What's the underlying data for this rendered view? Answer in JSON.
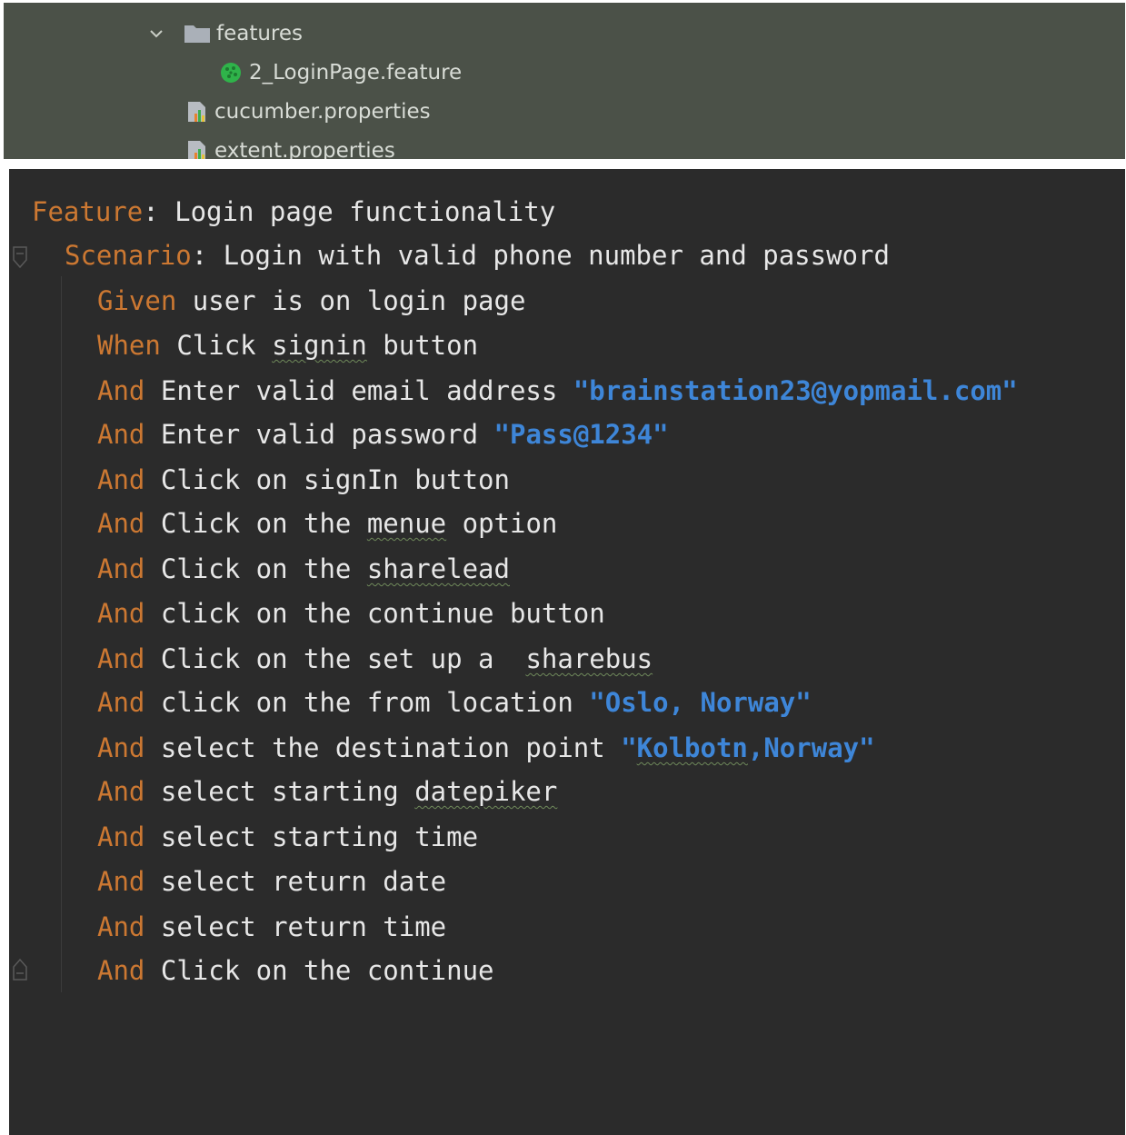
{
  "colors": {
    "tree_background": "#4b5148",
    "editor_background": "#2b2b2b",
    "keyword": "#cc7832",
    "string": "#3e86d8",
    "text": "#e7e7e7"
  },
  "project_tree": {
    "items": [
      {
        "label": "features",
        "icon": "folder-icon",
        "expanded": true
      },
      {
        "label": "2_LoginPage.feature",
        "icon": "cucumber-icon"
      },
      {
        "label": "cucumber.properties",
        "icon": "properties-file-icon"
      },
      {
        "label": "extent.properties",
        "icon": "properties-file-icon"
      }
    ]
  },
  "editor": {
    "feature": {
      "keyword": "Feature",
      "title": "Login page functionality"
    },
    "scenario": {
      "keyword": "Scenario",
      "title": "Login with valid phone number and password"
    },
    "steps": [
      {
        "keyword": "Given",
        "text": "user is on login page"
      },
      {
        "keyword": "When",
        "pre": "Click ",
        "typo": "signin",
        "post": " button"
      },
      {
        "keyword": "And",
        "text": "Enter valid email address",
        "string": "\"brainstation23@yopmail.com\""
      },
      {
        "keyword": "And",
        "text": "Enter valid password",
        "string": "\"Pass@1234\""
      },
      {
        "keyword": "And",
        "text": "Click on signIn button"
      },
      {
        "keyword": "And",
        "pre": "Click on the ",
        "typo": "menue",
        "post": " option"
      },
      {
        "keyword": "And",
        "pre": "Click on the ",
        "typo": "sharelead",
        "post": ""
      },
      {
        "keyword": "And",
        "text": "click on the continue button"
      },
      {
        "keyword": "And",
        "pre": "Click on the set up a  ",
        "typo": "sharebus",
        "post": ""
      },
      {
        "keyword": "And",
        "text": "click on the from location",
        "string": "\"Oslo, Norway\""
      },
      {
        "keyword": "And",
        "text": "select the destination point",
        "str_open": "\"",
        "str_typo": "Kolbotn",
        "str_close": ",Norway\""
      },
      {
        "keyword": "And",
        "pre": "select starting ",
        "typo": "datepiker",
        "post": ""
      },
      {
        "keyword": "And",
        "text": "select starting time"
      },
      {
        "keyword": "And",
        "text": "select return date"
      },
      {
        "keyword": "And",
        "text": "select return time"
      },
      {
        "keyword": "And",
        "text": "Click on the continue"
      }
    ]
  }
}
